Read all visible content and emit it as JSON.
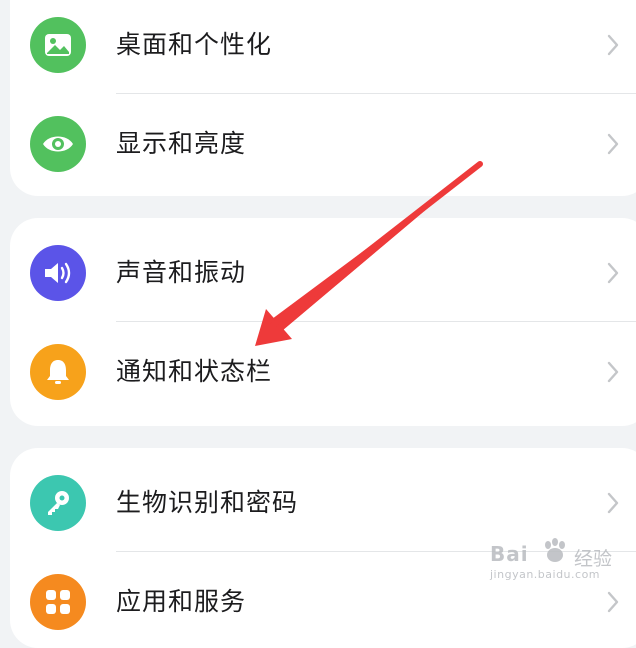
{
  "groups": [
    {
      "items": [
        {
          "label": "桌面和个性化",
          "icon": "wallpaper-icon",
          "icon_color": "#52c15e"
        },
        {
          "label": "显示和亮度",
          "icon": "eye-icon",
          "icon_color": "#52c15e"
        }
      ]
    },
    {
      "items": [
        {
          "label": "声音和振动",
          "icon": "speaker-icon",
          "icon_color": "#5b54e8"
        },
        {
          "label": "通知和状态栏",
          "icon": "bell-icon",
          "icon_color": "#f7a21b"
        }
      ]
    },
    {
      "items": [
        {
          "label": "生物识别和密码",
          "icon": "key-icon",
          "icon_color": "#3cc7b0"
        },
        {
          "label": "应用和服务",
          "icon": "apps-grid-icon",
          "icon_color": "#f58a1f"
        }
      ]
    }
  ],
  "annotation": {
    "arrow_color": "#ee3a3a"
  },
  "watermark": {
    "brand": "Bai",
    "brand_suffix": "经验",
    "url": "jingyan.baidu.com"
  }
}
